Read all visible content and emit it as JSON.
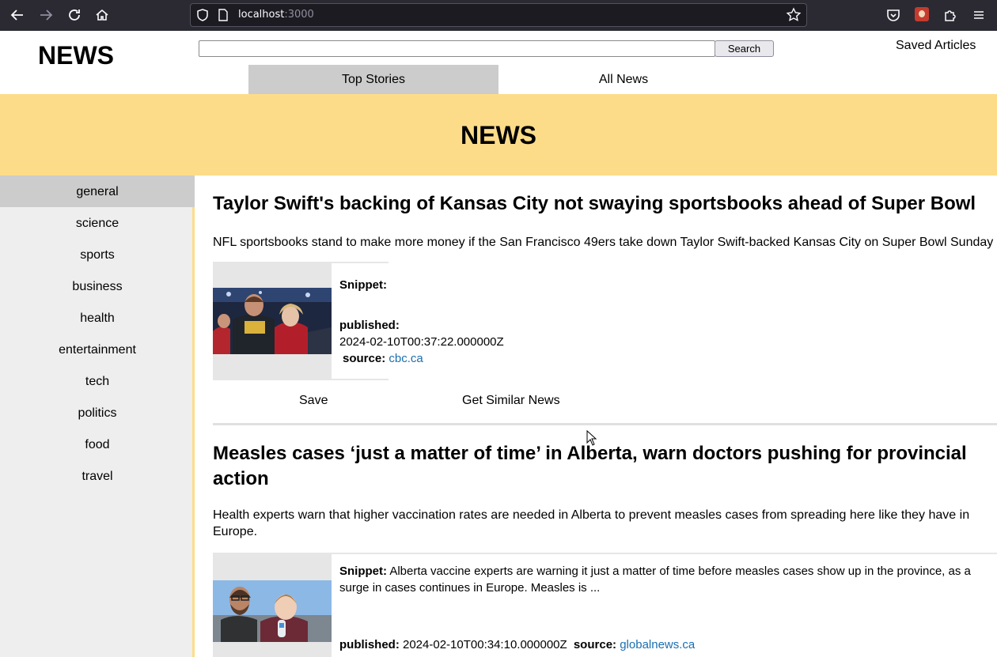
{
  "browser": {
    "url_host": "localhost",
    "url_port": ":3000"
  },
  "header": {
    "brand": "NEWS",
    "search_value": "",
    "search_button": "Search",
    "saved_articles": "Saved Articles",
    "tabs": [
      {
        "label": "Top Stories",
        "active": true
      },
      {
        "label": "All News",
        "active": false
      }
    ]
  },
  "banner": {
    "title": "NEWS"
  },
  "sidebar": {
    "items": [
      {
        "label": "general",
        "active": true
      },
      {
        "label": "science"
      },
      {
        "label": "sports"
      },
      {
        "label": "business"
      },
      {
        "label": "health"
      },
      {
        "label": "entertainment"
      },
      {
        "label": "tech"
      },
      {
        "label": "politics"
      },
      {
        "label": "food"
      },
      {
        "label": "travel"
      }
    ]
  },
  "articles": [
    {
      "title": "Taylor Swift's backing of Kansas City not swaying sportsbooks ahead of Super Bowl",
      "description": "NFL sportsbooks stand to make more money if the San Francisco 49ers take down Taylor Swift-backed Kansas City on Super Bowl Sunday",
      "snippet_label": "Snippet:",
      "snippet": "",
      "published_label": "published:",
      "published": "2024-02-10T00:37:22.000000Z",
      "source_label": "source:",
      "source": "cbc.ca",
      "save_label": "Save",
      "similar_label": "Get Similar News"
    },
    {
      "title": "Measles cases ‘just a matter of time’ in Alberta, warn doctors pushing for provincial action",
      "description": "Health experts warn that higher vaccination rates are needed in Alberta to prevent measles cases from spreading here like they have in Europe.",
      "snippet_label": "Snippet:",
      "snippet": "Alberta vaccine experts are warning it just a matter of time before measles cases show up in the province, as a surge in cases continues in Europe. Measles is ...",
      "published_label": "published:",
      "published": "2024-02-10T00:34:10.000000Z",
      "source_label": "source:",
      "source": "globalnews.ca"
    }
  ],
  "colors": {
    "banner": "#fddc89",
    "active_tab": "#cccccc",
    "sidebar_bg": "#eeeeee",
    "link": "#1a6fb0",
    "chrome": "#2b2a33"
  }
}
